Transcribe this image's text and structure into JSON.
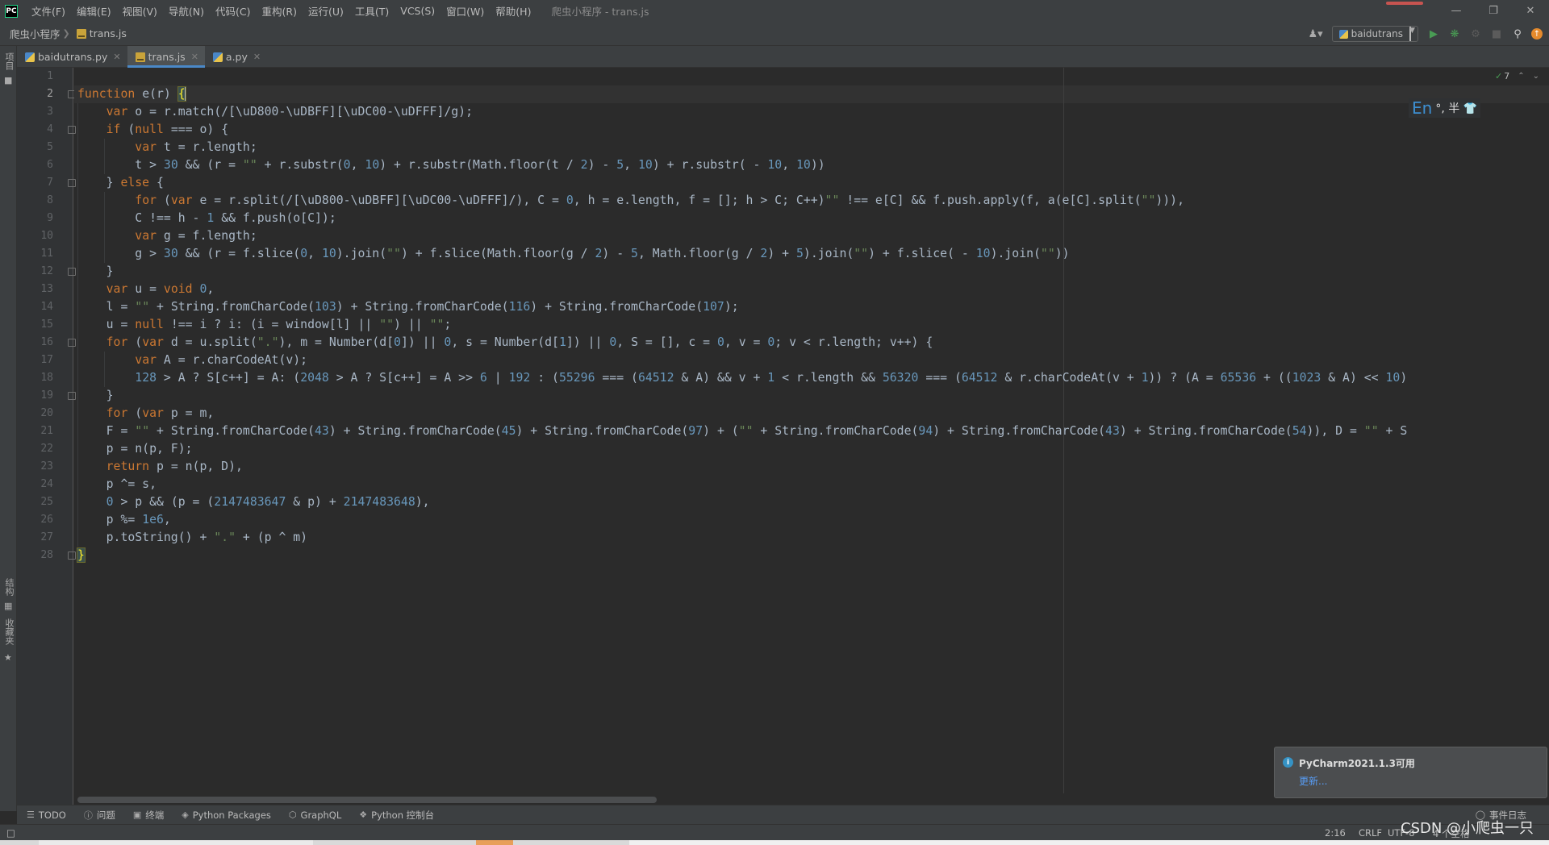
{
  "app": {
    "logo_text": "PC",
    "window_title": "爬虫小程序 - trans.js"
  },
  "menu": [
    "文件(F)",
    "编辑(E)",
    "视图(V)",
    "导航(N)",
    "代码(C)",
    "重构(R)",
    "运行(U)",
    "工具(T)",
    "VCS(S)",
    "窗口(W)",
    "帮助(H)"
  ],
  "breadcrumb": {
    "project": "爬虫小程序",
    "file": "trans.js"
  },
  "run_config": {
    "label": "baidutrans"
  },
  "left_strip": {
    "project_label": "项目",
    "structure_label": "结构",
    "favorites_label": "收藏夹"
  },
  "tabs": [
    {
      "label": "baidutrans.py",
      "type": "py",
      "active": false
    },
    {
      "label": "trans.js",
      "type": "js",
      "active": true
    },
    {
      "label": "a.py",
      "type": "py",
      "active": false
    }
  ],
  "inspection": {
    "ok_count": "7"
  },
  "ime": {
    "mode": "En",
    "rest": "°, 半 👕"
  },
  "editor": {
    "current_line": 2,
    "line_numbers": [
      "1",
      "2",
      "3",
      "4",
      "5",
      "6",
      "7",
      "8",
      "9",
      "10",
      "11",
      "12",
      "13",
      "14",
      "15",
      "16",
      "17",
      "18",
      "19",
      "20",
      "21",
      "22",
      "23",
      "24",
      "25",
      "26",
      "27",
      "28"
    ],
    "lines": [
      "",
      "function e(r) {",
      "    var o = r.match(/[\\uD800-\\uDBFF][\\uDC00-\\uDFFF]/g);",
      "    if (null === o) {",
      "        var t = r.length;",
      "        t > 30 && (r = \"\" + r.substr(0, 10) + r.substr(Math.floor(t / 2) - 5, 10) + r.substr( - 10, 10))",
      "    } else {",
      "        for (var e = r.split(/[\\uD800-\\uDBFF][\\uDC00-\\uDFFF]/), C = 0, h = e.length, f = []; h > C; C++)\"\" !== e[C] && f.push.apply(f, a(e[C].split(\"\"))),",
      "        C !== h - 1 && f.push(o[C]);",
      "        var g = f.length;",
      "        g > 30 && (r = f.slice(0, 10).join(\"\") + f.slice(Math.floor(g / 2) - 5, Math.floor(g / 2) + 5).join(\"\") + f.slice( - 10).join(\"\"))",
      "    }",
      "    var u = void 0,",
      "    l = \"\" + String.fromCharCode(103) + String.fromCharCode(116) + String.fromCharCode(107);",
      "    u = null !== i ? i: (i = window[l] || \"\") || \"\";",
      "    for (var d = u.split(\".\"), m = Number(d[0]) || 0, s = Number(d[1]) || 0, S = [], c = 0, v = 0; v < r.length; v++) {",
      "        var A = r.charCodeAt(v);",
      "        128 > A ? S[c++] = A: (2048 > A ? S[c++] = A >> 6 | 192 : (55296 === (64512 & A) && v + 1 < r.length && 56320 === (64512 & r.charCodeAt(v + 1)) ? (A = 65536 + ((1023 & A) << 10)",
      "    }",
      "    for (var p = m,",
      "    F = \"\" + String.fromCharCode(43) + String.fromCharCode(45) + String.fromCharCode(97) + (\"\" + String.fromCharCode(94) + String.fromCharCode(43) + String.fromCharCode(54)), D = \"\" + S",
      "    p = n(p, F);",
      "    return p = n(p, D),",
      "    p ^= s,",
      "    0 > p && (p = (2147483647 & p) + 2147483648),",
      "    p %= 1e6,",
      "    p.toString() + \".\" + (p ^ m)",
      "}"
    ]
  },
  "notification": {
    "title": "PyCharm2021.1.3可用",
    "link": "更新..."
  },
  "tool_windows": [
    {
      "label": "TODO",
      "icon": "list-icon"
    },
    {
      "label": "问题",
      "icon": "info-icon"
    },
    {
      "label": "终端",
      "icon": "terminal-icon"
    },
    {
      "label": "Python Packages",
      "icon": "package-icon"
    },
    {
      "label": "GraphQL",
      "icon": "graphql-icon"
    },
    {
      "label": "Python 控制台",
      "icon": "python-console-icon"
    }
  ],
  "event_log": "事件日志",
  "status": {
    "position": "2:16",
    "line_sep": "CRLF",
    "encoding": "UTF-8",
    "indent": "4 个空格",
    "watermark": "CSDN @小爬虫一只"
  }
}
